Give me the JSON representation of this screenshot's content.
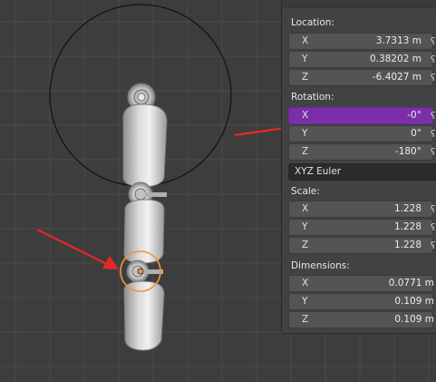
{
  "panel": {
    "location": {
      "label": "Location:",
      "x": {
        "axis": "X",
        "value": "3.7313 m"
      },
      "y": {
        "axis": "Y",
        "value": "0.38202 m"
      },
      "z": {
        "axis": "Z",
        "value": "-6.4027 m"
      }
    },
    "rotation": {
      "label": "Rotation:",
      "x": {
        "axis": "X",
        "value": "-0°"
      },
      "y": {
        "axis": "Y",
        "value": "0°"
      },
      "z": {
        "axis": "Z",
        "value": "-180°"
      },
      "mode": "XYZ Euler"
    },
    "scale": {
      "label": "Scale:",
      "x": {
        "axis": "X",
        "value": "1.228"
      },
      "y": {
        "axis": "Y",
        "value": "1.228"
      },
      "z": {
        "axis": "Z",
        "value": "1.228"
      }
    },
    "dimensions": {
      "label": "Dimensions:",
      "x": {
        "axis": "X",
        "value": "0.0771 m"
      },
      "y": {
        "axis": "Y",
        "value": "0.109 m"
      },
      "z": {
        "axis": "Z",
        "value": "0.109 m"
      }
    }
  },
  "colors": {
    "viewport_bg": "#3d3d3d",
    "grid": "#4a4a4a",
    "active_field": "#7a2fa8",
    "annotation_arrow": "#e8262a",
    "selection_ring": "#f0963c"
  },
  "icons": [
    "lock-icon",
    "annotation-arrow",
    "origin-dot"
  ]
}
